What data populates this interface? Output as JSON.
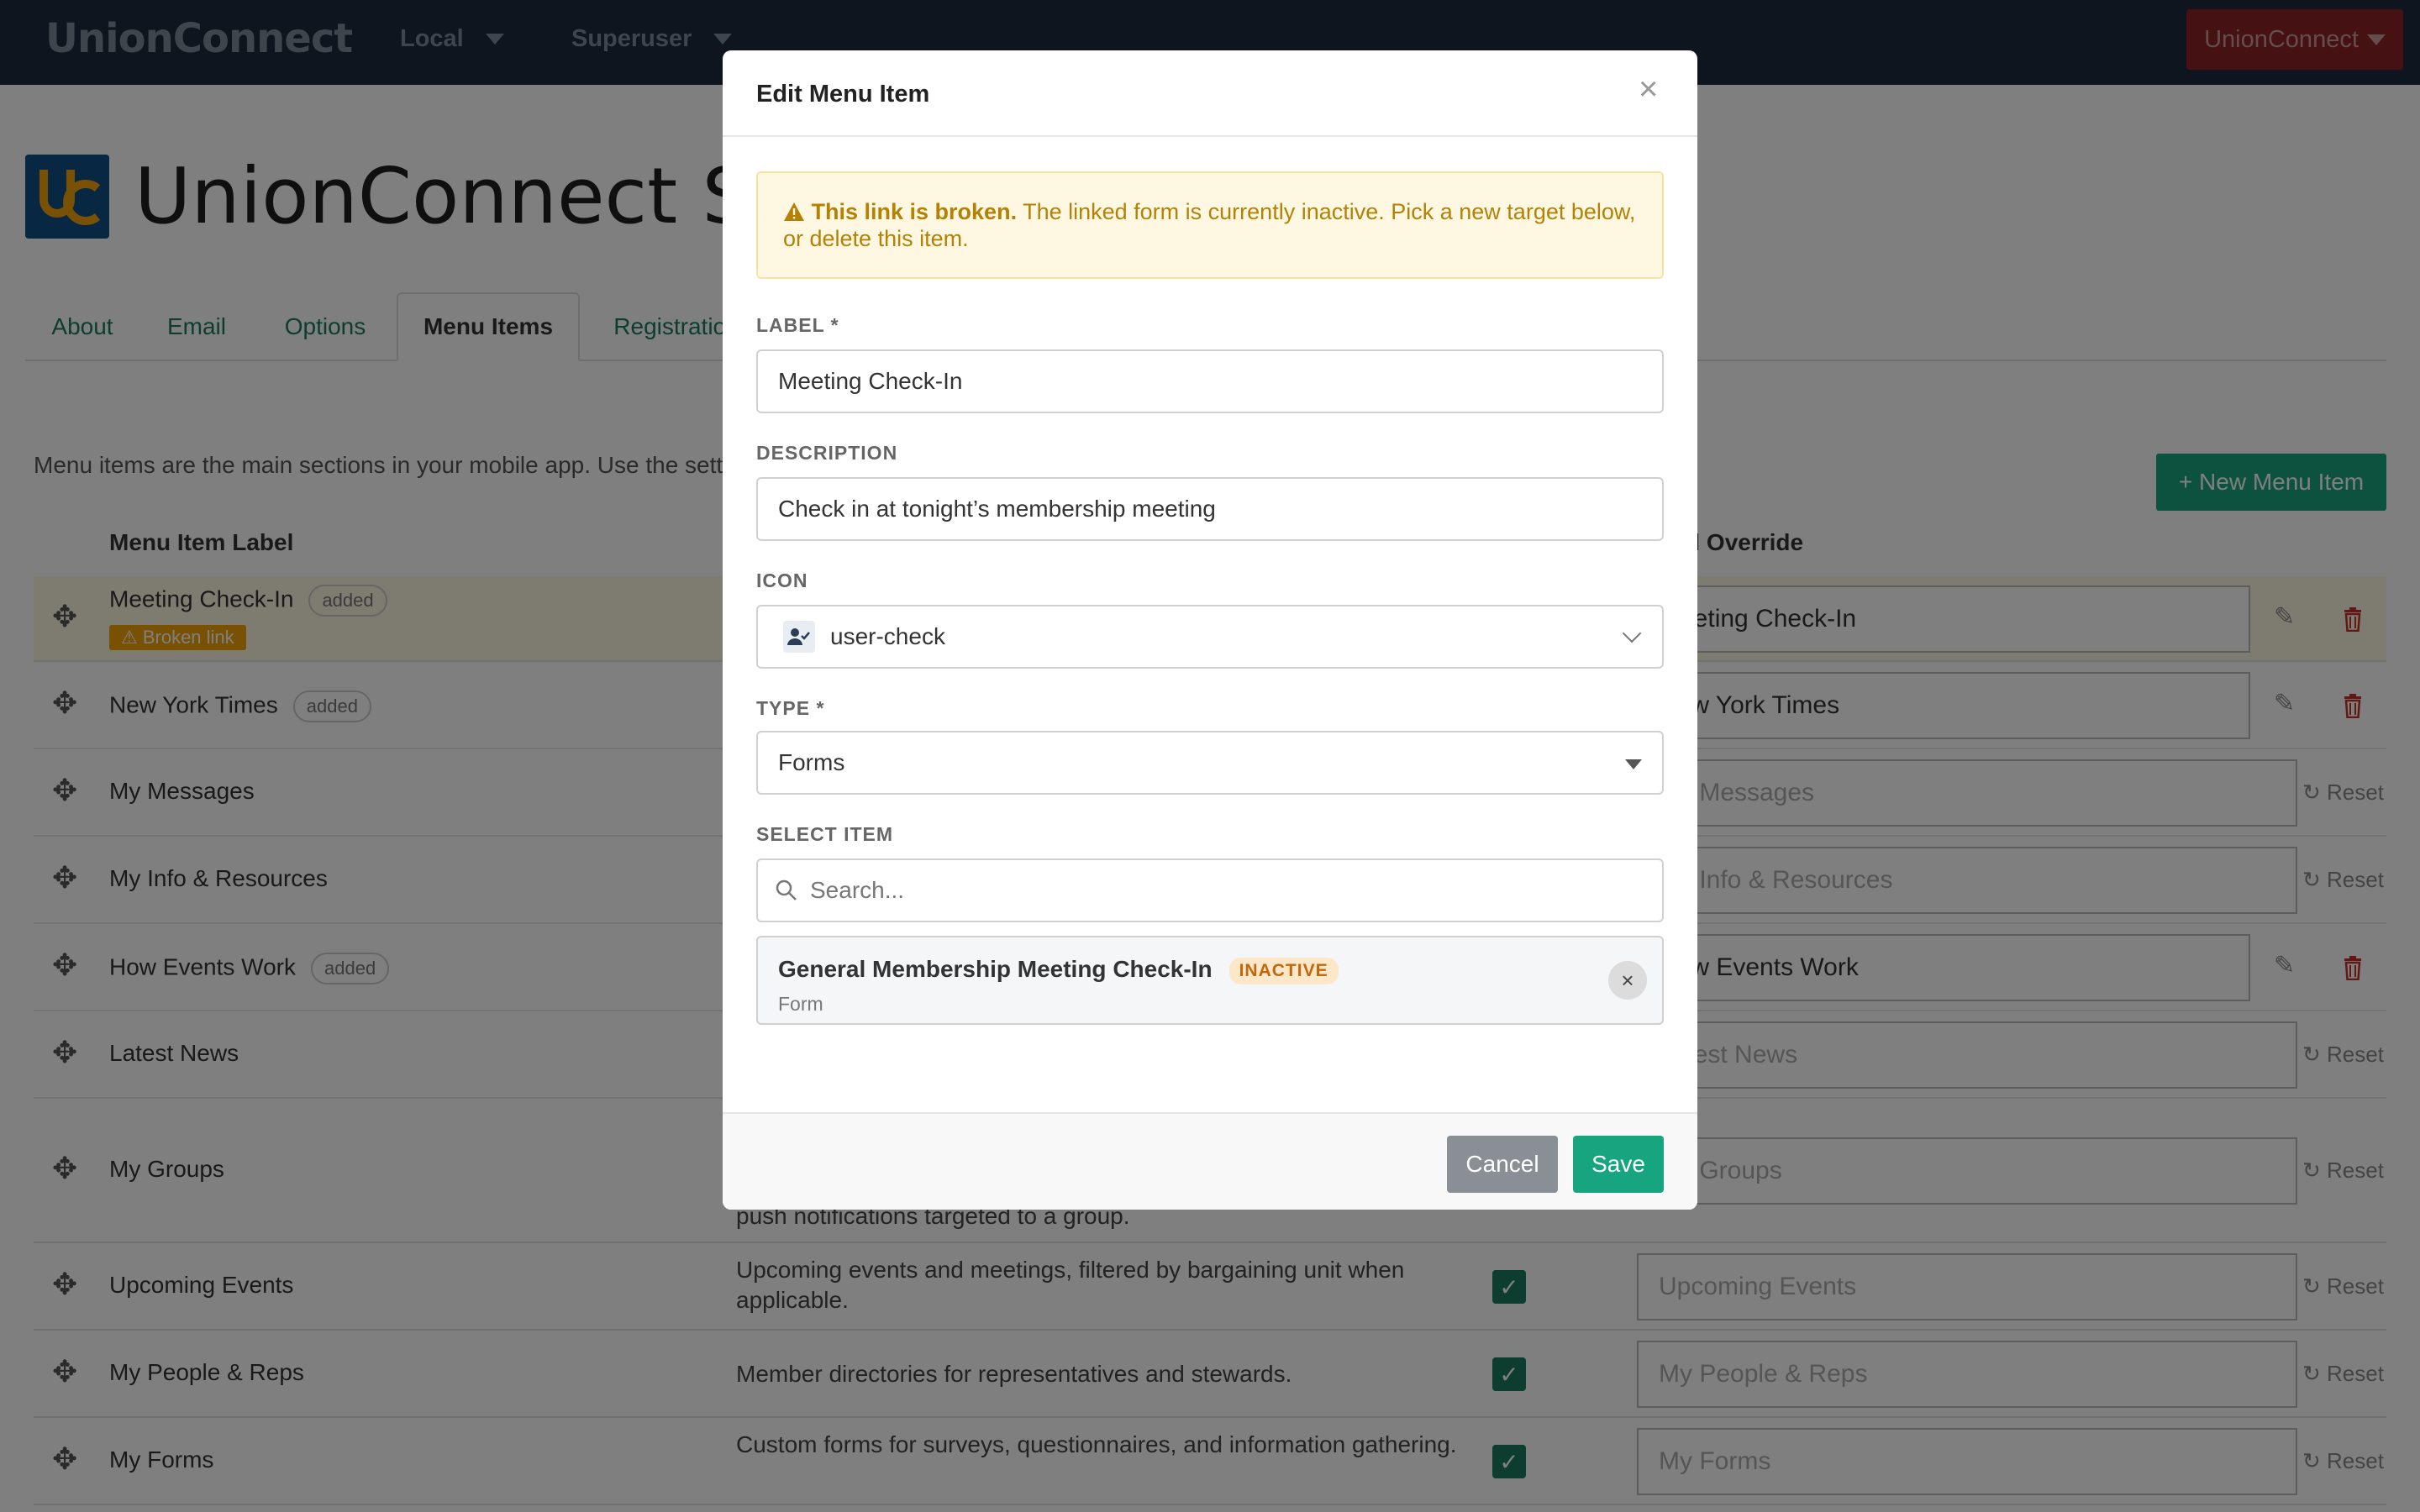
{
  "navbar": {
    "brand": "UnionConnect",
    "env_label": "Local",
    "user_label": "Superuser",
    "account_label": "UnionConnect"
  },
  "page": {
    "title": "UnionConnect Settings",
    "tabs": [
      {
        "label": "About"
      },
      {
        "label": "Email"
      },
      {
        "label": "Options"
      },
      {
        "label": "Menu Items",
        "active": true
      },
      {
        "label": "Registration"
      }
    ],
    "intro": "Menu items are the main sections in your mobile app. Use the settings",
    "new_button": "+ New Menu Item",
    "col_label": "Menu Item Label",
    "col_override": "Label Override"
  },
  "menu_rows": [
    {
      "label": "Meeting Check-In",
      "added": "added",
      "broken": "⚠ Broken link",
      "override": "Meeting Check-In",
      "mode": "custom",
      "highlight": true
    },
    {
      "label": "New York Times",
      "added": "added",
      "override": "New York Times",
      "mode": "custom"
    },
    {
      "label": "My Messages",
      "override": "My Messages",
      "mode": "default",
      "reset": "Reset"
    },
    {
      "label": "My Info & Resources",
      "override": "My Info & Resources",
      "mode": "default",
      "reset": "Reset"
    },
    {
      "label": "How Events Work",
      "added": "added",
      "override": "How Events Work",
      "mode": "custom"
    },
    {
      "label": "Latest News",
      "override": "Latest News",
      "mode": "default",
      "reset": "Reset"
    },
    {
      "label": "My Groups",
      "desc": "push notifications targeted to a group.",
      "override": "My Groups",
      "mode": "default",
      "reset": "Reset"
    },
    {
      "label": "Upcoming Events",
      "desc": "Upcoming events and meetings, filtered by bargaining unit when applicable.",
      "override": "Upcoming Events",
      "mode": "default",
      "reset": "Reset",
      "checked": true
    },
    {
      "label": "My People & Reps",
      "desc": "Member directories for representatives and stewards.",
      "override": "My People & Reps",
      "mode": "default",
      "reset": "Reset",
      "checked": true
    },
    {
      "label": "My Forms",
      "desc": "Custom forms for surveys, questionnaires, and information gathering.",
      "override": "My Forms",
      "mode": "default",
      "reset": "Reset",
      "checked": true
    }
  ],
  "modal": {
    "title": "Edit Menu Item",
    "close": "×",
    "alert_strong": "This link is broken.",
    "alert_text": "The linked form is currently inactive. Pick a new target below, or delete this item.",
    "label_field": {
      "label": "LABEL *",
      "value": "Meeting Check-In"
    },
    "description_field": {
      "label": "DESCRIPTION",
      "value": "Check in at tonight’s membership meeting"
    },
    "icon_field": {
      "label": "ICON",
      "value": "user-check",
      "icon": "user-check-icon"
    },
    "type_field": {
      "label": "TYPE *",
      "value": "Forms"
    },
    "select_item": {
      "label": "SELECT ITEM",
      "search_placeholder": "Search...",
      "selected_title": "General Membership Meeting Check-In",
      "selected_status": "INACTIVE",
      "selected_kind": "Form"
    },
    "cancel": "Cancel",
    "save": "Save"
  },
  "colors": {
    "navbar": "#1f2b3d",
    "accent_green": "#18a57e",
    "danger": "#c9302c",
    "warning": "#f0a30a"
  }
}
